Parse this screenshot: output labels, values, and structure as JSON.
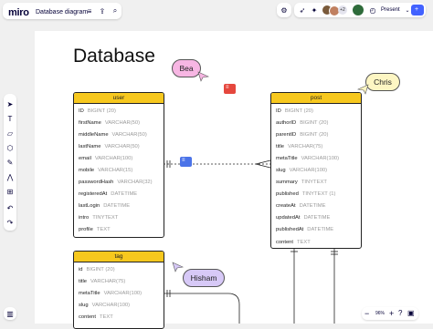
{
  "app": {
    "logo": "miro",
    "board_name": "Database diagram"
  },
  "toolbar": {
    "icons": [
      "menu-icon",
      "share-icon",
      "search-icon"
    ],
    "present_label": "Present",
    "collaborator_count": "+2"
  },
  "canvas": {
    "title": "Database",
    "stickers": {
      "bea": "Bea",
      "chris": "Chris",
      "hisham": "Hisham"
    }
  },
  "tables": {
    "user": {
      "name": "user",
      "rows": [
        {
          "field": "ID",
          "type": "BIGINT (20)"
        },
        {
          "field": "firstName",
          "type": "VARCHAR(50)"
        },
        {
          "field": "middleName",
          "type": "VARCHAR(50)"
        },
        {
          "field": "lastName",
          "type": "VARCHAR(50)"
        },
        {
          "field": "email",
          "type": "VARCHAR(100)"
        },
        {
          "field": "mobile",
          "type": "VARCHAR(15)"
        },
        {
          "field": "passwordHash",
          "type": "VARCHAR(32)"
        },
        {
          "field": "registeredAt",
          "type": "DATETIME"
        },
        {
          "field": "lastLogin",
          "type": "DATETIME"
        },
        {
          "field": "intro",
          "type": "TINYTEXT"
        },
        {
          "field": "profile",
          "type": "TEXT"
        }
      ]
    },
    "post": {
      "name": "post",
      "rows": [
        {
          "field": "ID",
          "type": "BIGINT (20)"
        },
        {
          "field": "authorID",
          "type": "BIGINT (20)"
        },
        {
          "field": "parentID",
          "type": "BIGINT (20)"
        },
        {
          "field": "title",
          "type": "VARCHAR(75)"
        },
        {
          "field": "metaTitle",
          "type": "VARCHAR(100)"
        },
        {
          "field": "slug",
          "type": "VARCHAR(100)"
        },
        {
          "field": "summary",
          "type": "TINYTEXT"
        },
        {
          "field": "published",
          "type": "TINYTEXT (1)"
        },
        {
          "field": "createAt",
          "type": "DATETIME"
        },
        {
          "field": "updatedAt",
          "type": "DATETIME"
        },
        {
          "field": "publishedAt",
          "type": "DATETIME"
        },
        {
          "field": "content",
          "type": "TEXT"
        }
      ]
    },
    "tag": {
      "name": "tag",
      "rows": [
        {
          "field": "id",
          "type": "BIGINT (20)"
        },
        {
          "field": "title",
          "type": "VARCHAR(75)"
        },
        {
          "field": "metaTitle",
          "type": "VARCHAR(100)"
        },
        {
          "field": "slug",
          "type": "VARCHAR(100)"
        },
        {
          "field": "content",
          "type": "TEXT"
        }
      ]
    }
  },
  "zoom": {
    "level": "96%"
  },
  "colors": {
    "header_yellow": "#f7c81e",
    "sticker_pink": "#f7b6e3",
    "sticker_yellow": "#fdf6c3",
    "sticker_purple": "#d7c9f7",
    "comment_red": "#e5473d",
    "comment_blue": "#4b73e8"
  }
}
